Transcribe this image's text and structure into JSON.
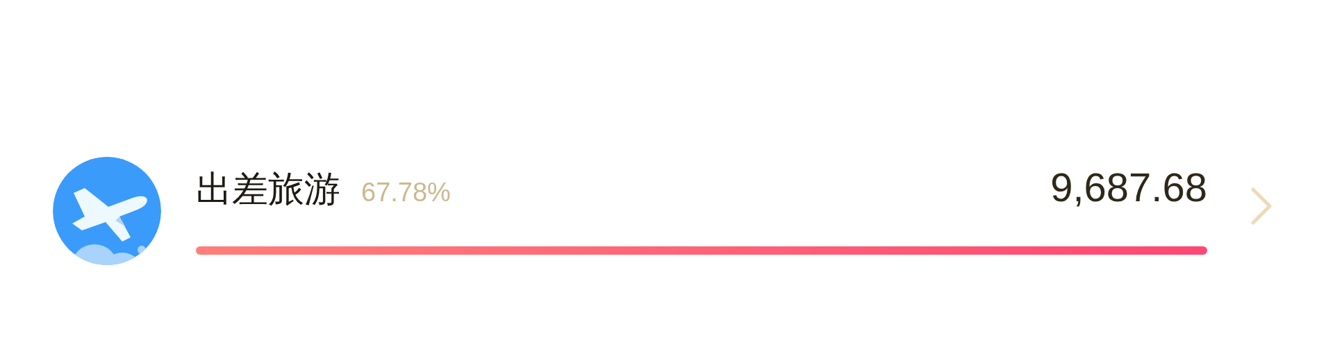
{
  "category": {
    "name": "出差旅游",
    "percent": "67.78%",
    "amount": "9,687.68",
    "level": 1
  }
}
